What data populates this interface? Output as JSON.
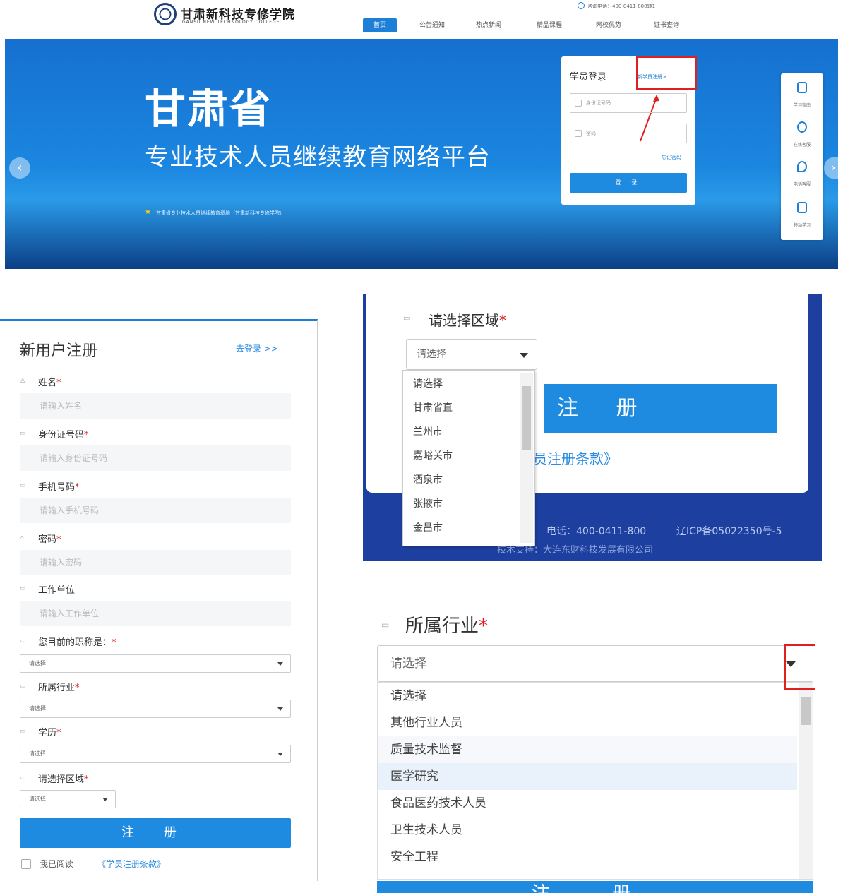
{
  "header": {
    "logo_cn": "甘肃新科技专修学院",
    "logo_en": "GANSU NEW TECHNOLOGY COLLEGE",
    "hotline": "咨询电话：400-0411-800转1",
    "nav": [
      "首页",
      "公告通知",
      "热点新闻",
      "精品课程",
      "网校优势",
      "证书查询"
    ]
  },
  "banner": {
    "title": "甘肃省",
    "subtitle": "专业技术人员继续教育网络平台",
    "note": "甘肃省专业技术人员继续教育基地（甘肃新科技专修学院）",
    "arrow_left": "‹",
    "arrow_right": "›"
  },
  "login": {
    "title": "学员登录",
    "register_link": "新学员注册>",
    "id_placeholder": "身份证号码",
    "password_placeholder": "密码",
    "forgot": "忘记密码",
    "login_button": "登 录"
  },
  "side_toolbar": [
    "学习指南",
    "在线客服",
    "电话客服",
    "移动学习"
  ],
  "register": {
    "title": "新用户注册",
    "to_login": "去登录 >>",
    "name_label": "姓名",
    "name_placeholder": "请输入姓名",
    "id_label": "身份证号码",
    "id_placeholder": "请输入身份证号码",
    "phone_label": "手机号码",
    "phone_placeholder": "请输入手机号码",
    "password_label": "密码",
    "password_placeholder": "请输入密码",
    "work_label": "工作单位",
    "work_placeholder": "请输入工作单位",
    "title_label": "您目前的职称是：",
    "industry_label": "所属行业",
    "edu_label": "学历",
    "region_label": "请选择区域",
    "select_placeholder": "请选择",
    "required_mark": "*",
    "submit": "注 册",
    "agree_text": "我已阅读",
    "agree_link": "《学员注册条款》"
  },
  "region_zoom": {
    "label": "请选择区域",
    "selected": "请选择",
    "options": [
      "请选择",
      "甘肃省直",
      "兰州市",
      "嘉峪关市",
      "酒泉市",
      "张掖市",
      "金昌市"
    ],
    "register_button": "注 册",
    "terms": "员注册条款》",
    "footer_phone": "电话：400-0411-800",
    "footer_icp": "辽ICP备05022350号-5",
    "footer_tech": "技术支持：大连东财科技发展有限公司"
  },
  "industry_zoom": {
    "label": "所属行业",
    "selected": "请选择",
    "options": [
      "请选择",
      "其他行业人员",
      "质量技术监督",
      "医学研究",
      "食品医药技术人员",
      "卫生技术人员",
      "安全工程"
    ],
    "bottom_button": "注 册"
  },
  "colors": {
    "primary": "#1e8be0",
    "highlight_red": "#e02020",
    "banner_blue": "#1670d0"
  }
}
